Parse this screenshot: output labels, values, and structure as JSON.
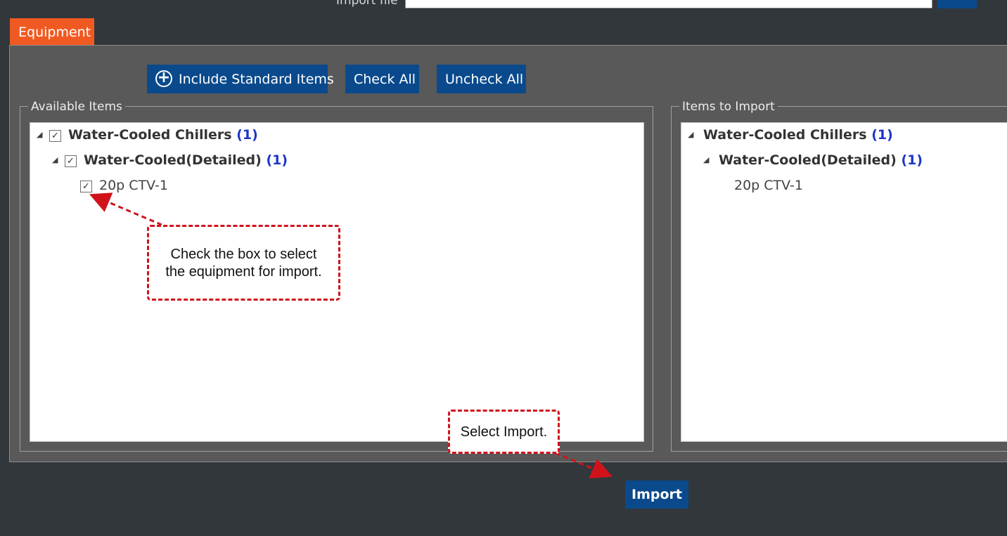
{
  "import_file": {
    "label": "Import file",
    "value": ""
  },
  "section": {
    "tab_label": "Equipment"
  },
  "toolbar": {
    "include_standard_label": "Include Standard Items",
    "check_all_label": "Check All",
    "uncheck_all_label": "Uncheck All"
  },
  "available": {
    "label": "Available Items",
    "tree": {
      "group_label": "Water-Cooled Chillers",
      "group_count": "(1)",
      "subgroup_label": "Water-Cooled(Detailed)",
      "subgroup_count": "(1)",
      "item_label": "20p CTV-1"
    }
  },
  "to_import": {
    "label": "Items to Import",
    "tree": {
      "group_label": "Water-Cooled Chillers",
      "group_count": "(1)",
      "subgroup_label": "Water-Cooled(Detailed)",
      "subgroup_count": "(1)",
      "item_label": "20p CTV-1"
    }
  },
  "callouts": {
    "checkbox_line1": "Check the box to select",
    "checkbox_line2": "the equipment for import.",
    "import": "Select Import."
  },
  "import_button_label": "Import",
  "colors": {
    "accent": "#f05a22",
    "button": "#0a4a8c",
    "count": "#1d36c8",
    "callout_border": "#d0131b"
  },
  "icons": {
    "expand": "triangle-down-icon",
    "check": "checkmark-icon",
    "plus": "plus-circle-icon"
  }
}
